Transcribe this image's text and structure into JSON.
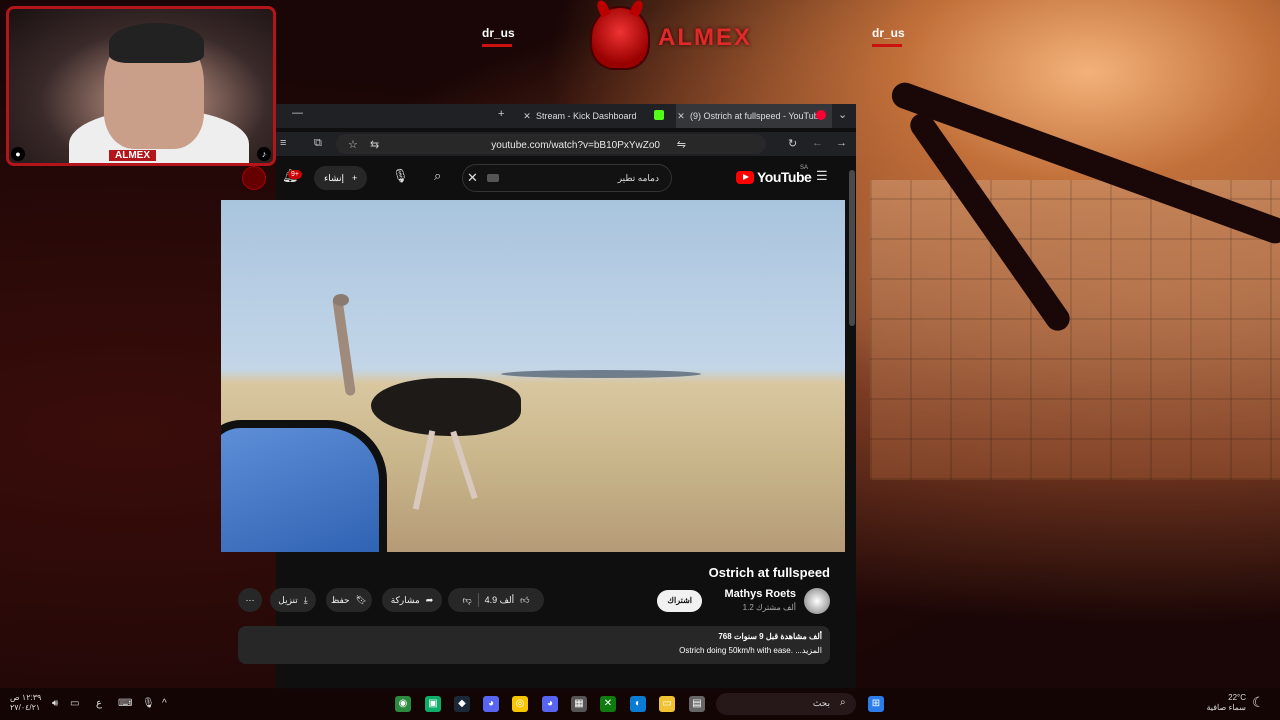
{
  "overlay": {
    "brand": "ALMEX",
    "social_left": "dr_us",
    "social_right": "dr_us",
    "cam_label": "ALMEX"
  },
  "browser": {
    "tabs": [
      {
        "title": "Stream - Kick Dashboard",
        "favicon_color": "#53fc18"
      },
      {
        "title": "(9) Ostrich at fullspeed - YouTube",
        "favicon_color": "#ff0033"
      }
    ],
    "url": "youtube.com/watch?v=bB10PxYwZo0"
  },
  "youtube": {
    "search_text": "دمامه تطير",
    "create_label": "إنشاء",
    "notification_count": "9+",
    "logo_text": "YouTube",
    "region": "SA",
    "video_title": "Ostrich at fullspeed",
    "channel_name": "Mathys Roets",
    "subscribers": "1.2 ألف مشترك",
    "subscribe_label": "اشتراك",
    "likes": "4.9 ألف",
    "share_label": "مشاركة",
    "save_label": "حفظ",
    "download_label": "تنزيل",
    "description_stats": "768 ألف مشاهدة قبل 9 سنوات",
    "description_text": "Ostrich doing 50km/h with ease. ...المزيد"
  },
  "taskbar": {
    "search_label": "بحث",
    "time": "١٢:٣٩ ص",
    "date": "٢٧/٠٤/٢١",
    "lang": "ع",
    "temperature": "22°C",
    "weather_text": "سماء صافية"
  },
  "colors": {
    "accent_red": "#e02a2a",
    "youtube_red": "#ff0000"
  }
}
